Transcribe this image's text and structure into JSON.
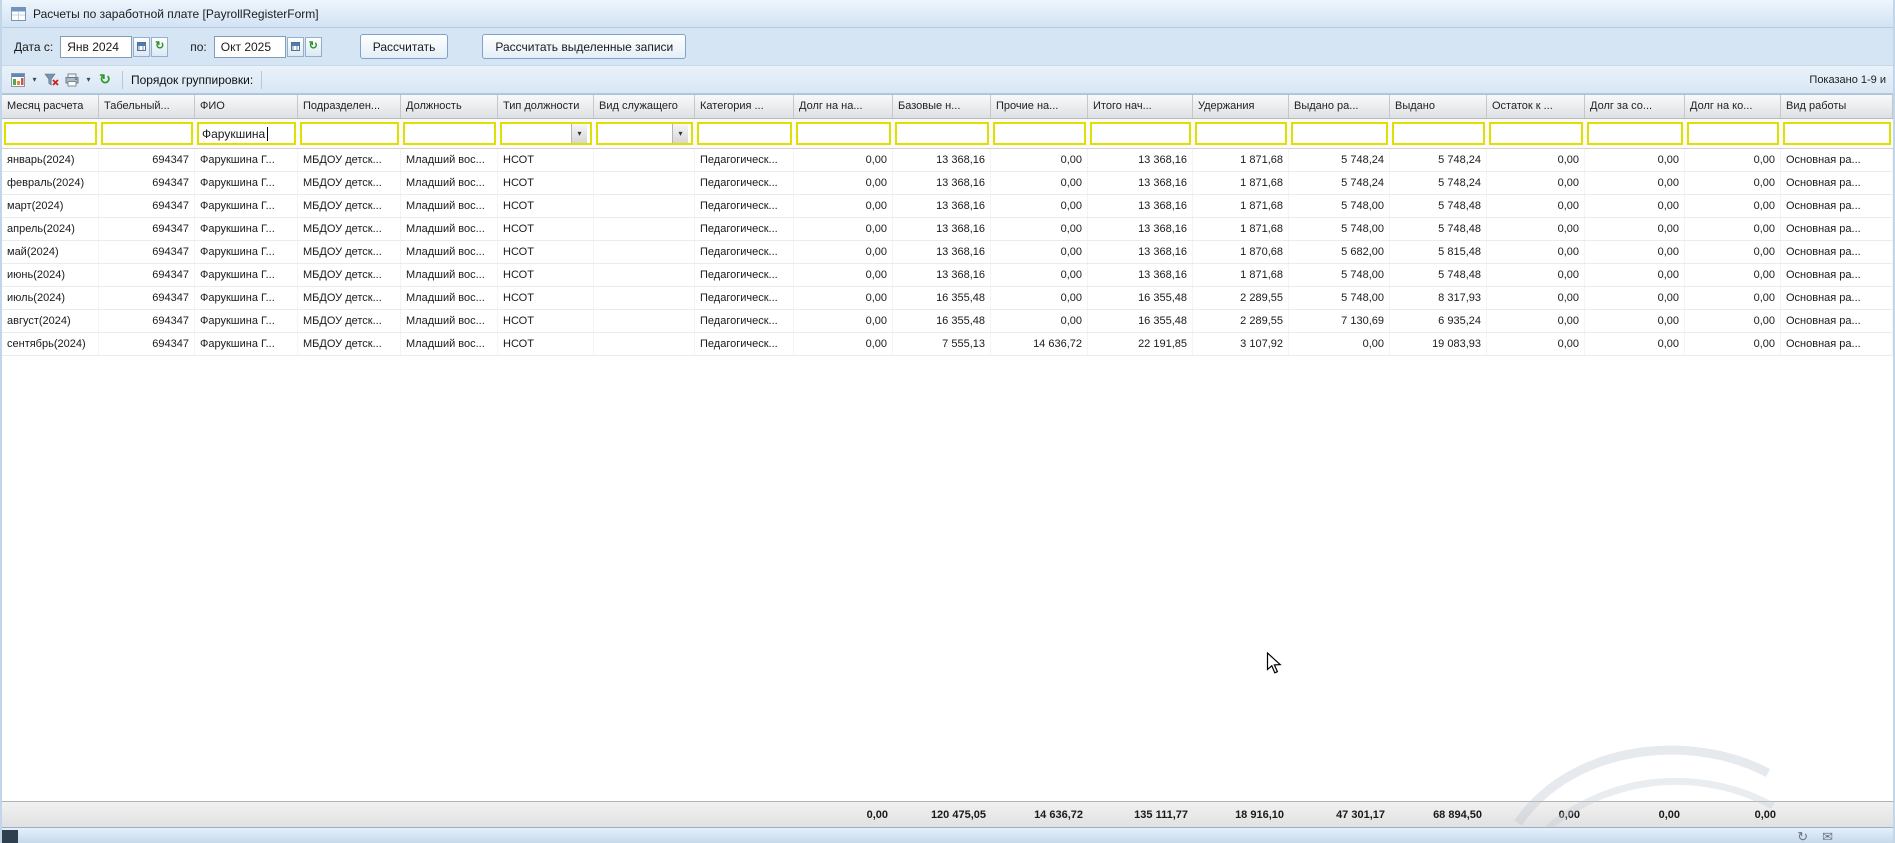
{
  "window": {
    "title": "Расчеты по заработной плате [PayrollRegisterForm]"
  },
  "toolbar": {
    "date_from_label": "Дата с:",
    "date_from_value": "Янв 2024",
    "date_to_label": "по:",
    "date_to_value": "Окт 2025",
    "calculate_button": "Рассчитать",
    "calculate_selected_button": "Рассчитать выделенные записи"
  },
  "grid_toolbar": {
    "grouping_label": "Порядок группировки:",
    "shown_text": "Показано 1-9 и"
  },
  "icons": {
    "dropdown_arrow": "▾",
    "refresh_glyph": "↻",
    "tray_glyph_1": "↻",
    "tray_glyph_2": "✉"
  },
  "colors": {
    "filter_highlight_border": "#dfdf00",
    "button_border": "#7da2ce",
    "chrome_blue": "#d6e5f3"
  },
  "grid": {
    "columns": [
      {
        "label": "Месяц расчета",
        "align": "left"
      },
      {
        "label": "Табельный...",
        "align": "right"
      },
      {
        "label": "ФИО",
        "align": "left"
      },
      {
        "label": "Подразделен...",
        "align": "left"
      },
      {
        "label": "Должность",
        "align": "left"
      },
      {
        "label": "Тип должности",
        "align": "left",
        "filter": "combo"
      },
      {
        "label": "Вид служащего",
        "align": "left",
        "filter": "combo"
      },
      {
        "label": "Категория ...",
        "align": "left"
      },
      {
        "label": "Долг на на...",
        "align": "right"
      },
      {
        "label": "Базовые н...",
        "align": "right"
      },
      {
        "label": "Прочие на...",
        "align": "right"
      },
      {
        "label": "Итого нач...",
        "align": "right"
      },
      {
        "label": "Удержания",
        "align": "right"
      },
      {
        "label": "Выдано ра...",
        "align": "right"
      },
      {
        "label": "Выдано",
        "align": "right"
      },
      {
        "label": "Остаток к ...",
        "align": "right"
      },
      {
        "label": "Долг за со...",
        "align": "right"
      },
      {
        "label": "Долг на ко...",
        "align": "right"
      },
      {
        "label": "Вид работы",
        "align": "left"
      }
    ],
    "filter_values": [
      "",
      "",
      "Фарукшина",
      "",
      "",
      "",
      "",
      "",
      "",
      "",
      "",
      "",
      "",
      "",
      "",
      "",
      "",
      "",
      ""
    ],
    "rows": [
      [
        "январь(2024)",
        "694347",
        "Фарукшина Г...",
        "МБДОУ детск...",
        "Младший вос...",
        "НСОТ",
        "",
        "Педагогическ...",
        "0,00",
        "13 368,16",
        "0,00",
        "13 368,16",
        "1 871,68",
        "5 748,24",
        "5 748,24",
        "0,00",
        "0,00",
        "0,00",
        "Основная ра..."
      ],
      [
        "февраль(2024)",
        "694347",
        "Фарукшина Г...",
        "МБДОУ детск...",
        "Младший вос...",
        "НСОТ",
        "",
        "Педагогическ...",
        "0,00",
        "13 368,16",
        "0,00",
        "13 368,16",
        "1 871,68",
        "5 748,24",
        "5 748,24",
        "0,00",
        "0,00",
        "0,00",
        "Основная ра..."
      ],
      [
        "март(2024)",
        "694347",
        "Фарукшина Г...",
        "МБДОУ детск...",
        "Младший вос...",
        "НСОТ",
        "",
        "Педагогическ...",
        "0,00",
        "13 368,16",
        "0,00",
        "13 368,16",
        "1 871,68",
        "5 748,00",
        "5 748,48",
        "0,00",
        "0,00",
        "0,00",
        "Основная ра..."
      ],
      [
        "апрель(2024)",
        "694347",
        "Фарукшина Г...",
        "МБДОУ детск...",
        "Младший вос...",
        "НСОТ",
        "",
        "Педагогическ...",
        "0,00",
        "13 368,16",
        "0,00",
        "13 368,16",
        "1 871,68",
        "5 748,00",
        "5 748,48",
        "0,00",
        "0,00",
        "0,00",
        "Основная ра..."
      ],
      [
        "май(2024)",
        "694347",
        "Фарукшина Г...",
        "МБДОУ детск...",
        "Младший вос...",
        "НСОТ",
        "",
        "Педагогическ...",
        "0,00",
        "13 368,16",
        "0,00",
        "13 368,16",
        "1 870,68",
        "5 682,00",
        "5 815,48",
        "0,00",
        "0,00",
        "0,00",
        "Основная ра..."
      ],
      [
        "июнь(2024)",
        "694347",
        "Фарукшина Г...",
        "МБДОУ детск...",
        "Младший вос...",
        "НСОТ",
        "",
        "Педагогическ...",
        "0,00",
        "13 368,16",
        "0,00",
        "13 368,16",
        "1 871,68",
        "5 748,00",
        "5 748,48",
        "0,00",
        "0,00",
        "0,00",
        "Основная ра..."
      ],
      [
        "июль(2024)",
        "694347",
        "Фарукшина Г...",
        "МБДОУ детск...",
        "Младший вос...",
        "НСОТ",
        "",
        "Педагогическ...",
        "0,00",
        "16 355,48",
        "0,00",
        "16 355,48",
        "2 289,55",
        "5 748,00",
        "8 317,93",
        "0,00",
        "0,00",
        "0,00",
        "Основная ра..."
      ],
      [
        "август(2024)",
        "694347",
        "Фарукшина Г...",
        "МБДОУ детск...",
        "Младший вос...",
        "НСОТ",
        "",
        "Педагогическ...",
        "0,00",
        "16 355,48",
        "0,00",
        "16 355,48",
        "2 289,55",
        "7 130,69",
        "6 935,24",
        "0,00",
        "0,00",
        "0,00",
        "Основная ра..."
      ],
      [
        "сентябрь(2024)",
        "694347",
        "Фарукшина Г...",
        "МБДОУ детск...",
        "Младший вос...",
        "НСОТ",
        "",
        "Педагогическ...",
        "0,00",
        "7 555,13",
        "14 636,72",
        "22 191,85",
        "3 107,92",
        "0,00",
        "19 083,93",
        "0,00",
        "0,00",
        "0,00",
        "Основная ра..."
      ]
    ],
    "totals": [
      "",
      "",
      "",
      "",
      "",
      "",
      "",
      "",
      "0,00",
      "120 475,05",
      "14 636,72",
      "135 111,77",
      "18 916,10",
      "47 301,17",
      "68 894,50",
      "0,00",
      "0,00",
      "0,00",
      ""
    ]
  }
}
